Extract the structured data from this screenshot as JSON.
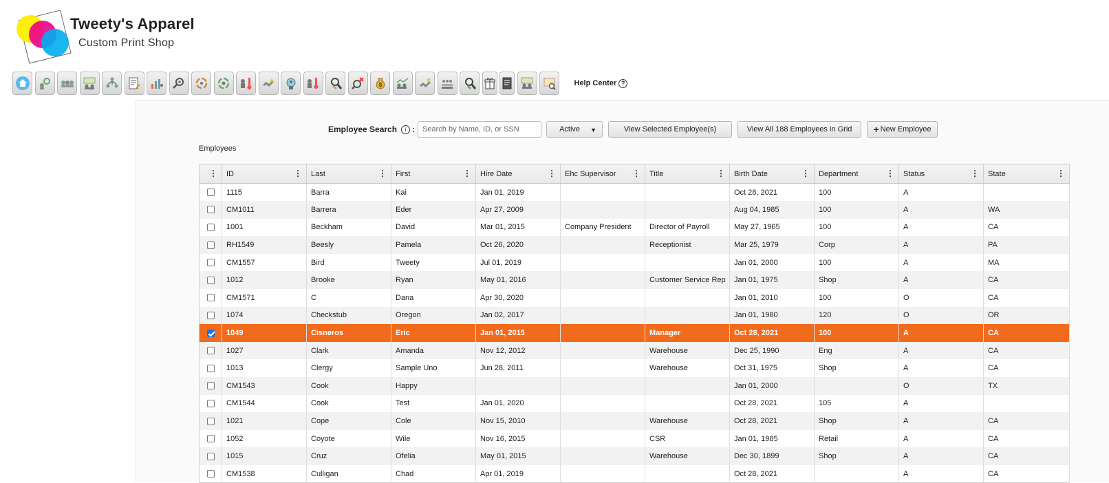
{
  "brand": {
    "name": "Tweety's Apparel",
    "subtitle": "Custom Print Shop",
    "colors": {
      "yellow": "#ffee00",
      "magenta": "#ec008c",
      "cyan": "#00aeef"
    }
  },
  "toolbar": {
    "icons": [
      "home-icon",
      "settings-people-icon",
      "people-group-icon",
      "org-chart-icon",
      "hierarchy-icon",
      "document-edit-icon",
      "chart-people-icon",
      "search-add-icon",
      "cycle-icon",
      "cycle-settings-icon",
      "thermometer-icon",
      "handshake-icon",
      "badge-icon",
      "thermometer-hand-icon",
      "search-hand-icon",
      "search-remove-icon",
      "money-bag-icon",
      "people-chart-icon",
      "handshake-up-icon",
      "bank-icon",
      "search-gear-icon",
      "gift-icon",
      "document-icon",
      "people-board-icon",
      "certificate-icon"
    ],
    "help_label": "Help Center",
    "help_icon": "?"
  },
  "search": {
    "label": "Employee Search",
    "info_icon": "i",
    "colon": ":",
    "placeholder": "Search by Name, ID, or SSN",
    "status_filter": "Active",
    "view_selected_label": "View Selected Employee(s)",
    "view_all_label": "View All 188 Employees in Grid",
    "new_employee_label": "New Employee"
  },
  "grid": {
    "title": "Employees",
    "columns": [
      "ID",
      "Last",
      "First",
      "Hire Date",
      "Ehc Supervisor",
      "Title",
      "Birth Date",
      "Department",
      "Status",
      "State"
    ],
    "rows": [
      {
        "checked": false,
        "cells": [
          "1115",
          "Barra",
          "Kai",
          "Jan 01, 2019",
          "",
          "",
          "Oct 28, 2021",
          "100",
          "A",
          ""
        ]
      },
      {
        "checked": false,
        "cells": [
          "CM1011",
          "Barrera",
          "Eder",
          "Apr 27, 2009",
          "",
          "",
          "Aug 04, 1985",
          "100",
          "A",
          "WA"
        ]
      },
      {
        "checked": false,
        "cells": [
          "1001",
          "Beckham",
          "David",
          "Mar 01, 2015",
          "Company President",
          "Director of Payroll",
          "May 27, 1965",
          "100",
          "A",
          "CA"
        ]
      },
      {
        "checked": false,
        "cells": [
          "RH1549",
          "Beesly",
          "Pamela",
          "Oct 26, 2020",
          "",
          "Receptionist",
          "Mar 25, 1979",
          "Corp",
          "A",
          "PA"
        ]
      },
      {
        "checked": false,
        "cells": [
          "CM1557",
          "Bird",
          "Tweety",
          "Jul 01, 2019",
          "",
          "",
          "Jan 01, 2000",
          "100",
          "A",
          "MA"
        ]
      },
      {
        "checked": false,
        "cells": [
          "1012",
          "Brooke",
          "Ryan",
          "May 01, 2016",
          "",
          "Customer Service Rep",
          "Jan 01, 1975",
          "Shop",
          "A",
          "CA"
        ]
      },
      {
        "checked": false,
        "cells": [
          "CM1571",
          "C",
          "Dana",
          "Apr 30, 2020",
          "",
          "",
          "Jan 01, 2010",
          "100",
          "O",
          "CA"
        ]
      },
      {
        "checked": false,
        "cells": [
          "1074",
          "Checkstub",
          "Oregon",
          "Jan 02, 2017",
          "",
          "",
          "Jan 01, 1980",
          "120",
          "O",
          "OR"
        ]
      },
      {
        "checked": true,
        "cells": [
          "1049",
          "Cisneros",
          "Eric",
          "Jan 01, 2015",
          "",
          "Manager",
          "Oct 28, 2021",
          "100",
          "A",
          "CA"
        ]
      },
      {
        "checked": false,
        "cells": [
          "1027",
          "Clark",
          "Amanda",
          "Nov 12, 2012",
          "",
          "Warehouse",
          "Dec 25, 1990",
          "Eng",
          "A",
          "CA"
        ]
      },
      {
        "checked": false,
        "cells": [
          "1013",
          "Clergy",
          "Sample Uno",
          "Jun 28, 2011",
          "",
          "Warehouse",
          "Oct 31, 1975",
          "Shop",
          "A",
          "CA"
        ]
      },
      {
        "checked": false,
        "cells": [
          "CM1543",
          "Cook",
          "Happy",
          "",
          "",
          "",
          "Jan 01, 2000",
          "",
          "O",
          "TX"
        ]
      },
      {
        "checked": false,
        "cells": [
          "CM1544",
          "Cook",
          "Test",
          "Jan 01, 2020",
          "",
          "",
          "Oct 28, 2021",
          "105",
          "A",
          ""
        ]
      },
      {
        "checked": false,
        "cells": [
          "1021",
          "Cope",
          "Cole",
          "Nov 15, 2010",
          "",
          "Warehouse",
          "Oct 28, 2021",
          "Shop",
          "A",
          "CA"
        ]
      },
      {
        "checked": false,
        "cells": [
          "1052",
          "Coyote",
          "Wile",
          "Nov 16, 2015",
          "",
          "CSR",
          "Jan 01, 1985",
          "Retail",
          "A",
          "CA"
        ]
      },
      {
        "checked": false,
        "cells": [
          "1015",
          "Cruz",
          "Ofelia",
          "May 01, 2015",
          "",
          "Warehouse",
          "Dec 30, 1899",
          "Shop",
          "A",
          "CA"
        ]
      },
      {
        "checked": false,
        "cells": [
          "CM1538",
          "Culligan",
          "Chad",
          "Apr 01, 2019",
          "",
          "",
          "Oct 28, 2021",
          "",
          "A",
          "CA"
        ]
      }
    ],
    "selected_row_color": "#f26b1d"
  }
}
